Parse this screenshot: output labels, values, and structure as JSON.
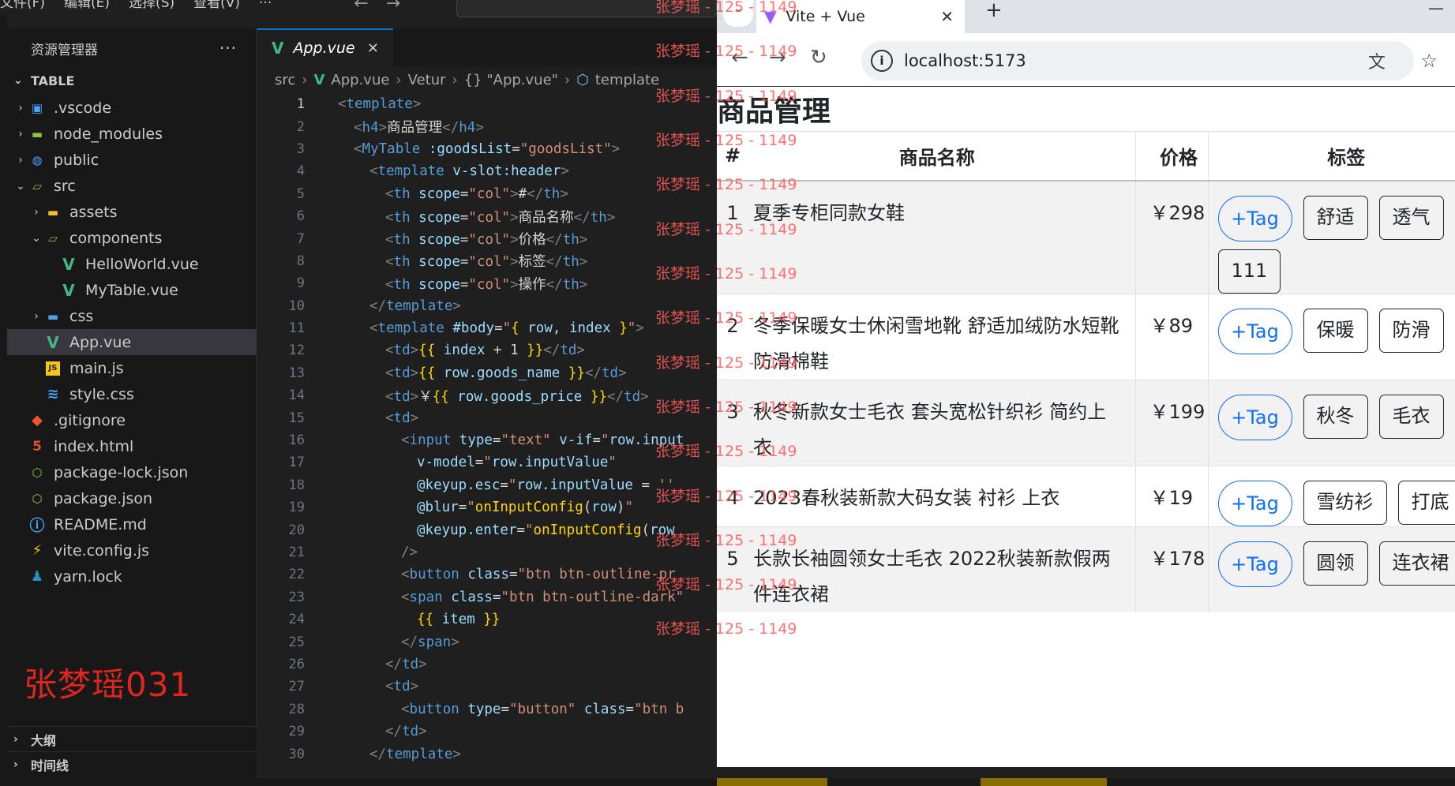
{
  "vscode": {
    "menu": [
      "文件(F)",
      "编辑(E)",
      "选择(S)",
      "查看(V)",
      "···"
    ],
    "explorer_title": "资源管理器",
    "explorer_more": "···",
    "root_folder": "TABLE",
    "tree": [
      {
        "label": ".vscode",
        "depth": 1,
        "chev": "›",
        "icon": "vscode-folder-icon",
        "glyph": "▣",
        "cls": "folder-blue"
      },
      {
        "label": "node_modules",
        "depth": 1,
        "chev": "›",
        "icon": "node-folder-icon",
        "glyph": "▬",
        "cls": "folder-green"
      },
      {
        "label": "public",
        "depth": 1,
        "chev": "›",
        "icon": "public-folder-icon",
        "glyph": "◍",
        "cls": "folder-blue"
      },
      {
        "label": "src",
        "depth": 1,
        "chev": "⌄",
        "icon": "src-folder-icon",
        "glyph": "▱",
        "cls": "folder-green"
      },
      {
        "label": "assets",
        "depth": 2,
        "chev": "›",
        "icon": "assets-folder-icon",
        "glyph": "▬",
        "cls": "folder-yellow"
      },
      {
        "label": "components",
        "depth": 2,
        "chev": "⌄",
        "icon": "components-folder-icon",
        "glyph": "▱",
        "cls": "folder-green"
      },
      {
        "label": "HelloWorld.vue",
        "depth": 3,
        "chev": "",
        "icon": "vue-file-icon",
        "glyph": "V",
        "cls": "vue"
      },
      {
        "label": "MyTable.vue",
        "depth": 3,
        "chev": "",
        "icon": "vue-file-icon",
        "glyph": "V",
        "cls": "vue"
      },
      {
        "label": "css",
        "depth": 2,
        "chev": "›",
        "icon": "css-folder-icon",
        "glyph": "▬",
        "cls": "folder-css"
      },
      {
        "label": "App.vue",
        "depth": 2,
        "chev": "",
        "icon": "vue-file-icon",
        "glyph": "V",
        "cls": "vue",
        "active": true
      },
      {
        "label": "main.js",
        "depth": 2,
        "chev": "",
        "icon": "js-file-icon",
        "glyph": "JS",
        "cls": "js"
      },
      {
        "label": "style.css",
        "depth": 2,
        "chev": "",
        "icon": "css-file-icon",
        "glyph": "≋",
        "cls": "css-file"
      },
      {
        "label": ".gitignore",
        "depth": 1,
        "chev": "",
        "icon": "git-icon",
        "glyph": "◆",
        "cls": "git"
      },
      {
        "label": "index.html",
        "depth": 1,
        "chev": "",
        "icon": "html-file-icon",
        "glyph": "5",
        "cls": "html"
      },
      {
        "label": "package-lock.json",
        "depth": 1,
        "chev": "",
        "icon": "json-file-icon",
        "glyph": "⬡",
        "cls": "json"
      },
      {
        "label": "package.json",
        "depth": 1,
        "chev": "",
        "icon": "json-file-icon",
        "glyph": "⬡",
        "cls": "json"
      },
      {
        "label": "README.md",
        "depth": 1,
        "chev": "",
        "icon": "info-icon",
        "glyph": "ⓘ",
        "cls": "info"
      },
      {
        "label": "vite.config.js",
        "depth": 1,
        "chev": "",
        "icon": "vite-bolt-icon",
        "glyph": "⚡",
        "cls": "bolt"
      },
      {
        "label": "yarn.lock",
        "depth": 1,
        "chev": "",
        "icon": "yarn-icon",
        "glyph": "♟",
        "cls": "yarn"
      }
    ],
    "watermark_name": "张梦瑶031",
    "outline_label": "大纲",
    "timeline_label": "时间线",
    "editor_tab": "App.vue",
    "breadcrumb": [
      "src",
      "App.vue",
      "Vetur",
      "{} \"App.vue\"",
      "template"
    ],
    "code_lines": [
      {
        "n": "1",
        "html": "<span class='t-br'>&lt;</span><span class='t-tag'>template</span><span class='t-br'>&gt;</span>",
        "indent": 0
      },
      {
        "n": "2",
        "html": "<span class='t-br'>&lt;</span><span class='t-tag'>h4</span><span class='t-br'>&gt;</span><span class='t-txt'>商品管理</span><span class='t-br'>&lt;/</span><span class='t-tag'>h4</span><span class='t-br'>&gt;</span>",
        "indent": 1
      },
      {
        "n": "3",
        "html": "<span class='t-br'>&lt;</span><span class='t-tag'>MyTable</span> <span class='t-attr'>:goodsList</span><span class='t-txt'>=</span><span class='t-str'>\"goodsList\"</span><span class='t-br'>&gt;</span>",
        "indent": 1
      },
      {
        "n": "4",
        "html": "<span class='t-br'>&lt;</span><span class='t-tag'>template</span> <span class='t-attr'>v-slot:header</span><span class='t-br'>&gt;</span>",
        "indent": 2
      },
      {
        "n": "5",
        "html": "<span class='t-br'>&lt;</span><span class='t-tag'>th</span> <span class='t-attr'>scope</span><span class='t-txt'>=</span><span class='t-str'>\"col\"</span><span class='t-br'>&gt;</span><span class='t-txt'>#</span><span class='t-br'>&lt;/</span><span class='t-tag'>th</span><span class='t-br'>&gt;</span>",
        "indent": 3
      },
      {
        "n": "6",
        "html": "<span class='t-br'>&lt;</span><span class='t-tag'>th</span> <span class='t-attr'>scope</span><span class='t-txt'>=</span><span class='t-str'>\"col\"</span><span class='t-br'>&gt;</span><span class='t-txt'>商品名称</span><span class='t-br'>&lt;/</span><span class='t-tag'>th</span><span class='t-br'>&gt;</span>",
        "indent": 3
      },
      {
        "n": "7",
        "html": "<span class='t-br'>&lt;</span><span class='t-tag'>th</span> <span class='t-attr'>scope</span><span class='t-txt'>=</span><span class='t-str'>\"col\"</span><span class='t-br'>&gt;</span><span class='t-txt'>价格</span><span class='t-br'>&lt;/</span><span class='t-tag'>th</span><span class='t-br'>&gt;</span>",
        "indent": 3
      },
      {
        "n": "8",
        "html": "<span class='t-br'>&lt;</span><span class='t-tag'>th</span> <span class='t-attr'>scope</span><span class='t-txt'>=</span><span class='t-str'>\"col\"</span><span class='t-br'>&gt;</span><span class='t-txt'>标签</span><span class='t-br'>&lt;/</span><span class='t-tag'>th</span><span class='t-br'>&gt;</span>",
        "indent": 3
      },
      {
        "n": "9",
        "html": "<span class='t-br'>&lt;</span><span class='t-tag'>th</span> <span class='t-attr'>scope</span><span class='t-txt'>=</span><span class='t-str'>\"col\"</span><span class='t-br'>&gt;</span><span class='t-txt'>操作</span><span class='t-br'>&lt;/</span><span class='t-tag'>th</span><span class='t-br'>&gt;</span>",
        "indent": 3
      },
      {
        "n": "10",
        "html": "<span class='t-br'>&lt;/</span><span class='t-tag'>template</span><span class='t-br'>&gt;</span>",
        "indent": 2
      },
      {
        "n": "11",
        "html": "<span class='t-br'>&lt;</span><span class='t-tag'>template</span> <span class='t-attr'>#body</span><span class='t-txt'>=</span><span class='t-str'>\"</span><span class='t-mus'>{</span> <span class='t-var'>row</span><span class='t-txt'>,</span> <span class='t-var'>index</span> <span class='t-mus'>}</span><span class='t-str'>\"</span><span class='t-br'>&gt;</span>",
        "indent": 2
      },
      {
        "n": "12",
        "html": "<span class='t-br'>&lt;</span><span class='t-tag'>td</span><span class='t-br'>&gt;</span><span class='t-mus'>{{</span> <span class='t-var'>index</span> <span class='t-txt'>+ 1</span> <span class='t-mus'>}}</span><span class='t-br'>&lt;/</span><span class='t-tag'>td</span><span class='t-br'>&gt;</span>",
        "indent": 3
      },
      {
        "n": "13",
        "html": "<span class='t-br'>&lt;</span><span class='t-tag'>td</span><span class='t-br'>&gt;</span><span class='t-mus'>{{</span> <span class='t-var'>row.goods_name</span> <span class='t-mus'>}}</span><span class='t-br'>&lt;/</span><span class='t-tag'>td</span><span class='t-br'>&gt;</span>",
        "indent": 3
      },
      {
        "n": "14",
        "html": "<span class='t-br'>&lt;</span><span class='t-tag'>td</span><span class='t-br'>&gt;</span><span class='t-txt'>￥</span><span class='t-mus'>{{</span> <span class='t-var'>row.goods_price</span> <span class='t-mus'>}}</span><span class='t-br'>&lt;/</span><span class='t-tag'>td</span><span class='t-br'>&gt;</span>",
        "indent": 3
      },
      {
        "n": "15",
        "html": "<span class='t-br'>&lt;</span><span class='t-tag'>td</span><span class='t-br'>&gt;</span>",
        "indent": 3
      },
      {
        "n": "16",
        "html": "<span class='t-br'>&lt;</span><span class='t-tag'>input</span> <span class='t-attr'>type</span><span class='t-txt'>=</span><span class='t-str'>\"text\"</span> <span class='t-attr'>v-if</span><span class='t-txt'>=</span><span class='t-str'>\"</span><span class='t-var'>row.input</span>",
        "indent": 4
      },
      {
        "n": "17",
        "html": "<span class='t-attr'>v-model</span><span class='t-txt'>=</span><span class='t-str'>\"</span><span class='t-var'>row.inputValue</span><span class='t-str'>\"</span>",
        "indent": 5
      },
      {
        "n": "18",
        "html": "<span class='t-attr'>@keyup.esc</span><span class='t-txt'>=</span><span class='t-str'>\"</span><span class='t-var'>row.inputValue</span> <span class='t-txt'>=</span> <span class='t-str'>''</span>",
        "indent": 5
      },
      {
        "n": "19",
        "html": "<span class='t-attr'>@blur</span><span class='t-txt'>=</span><span class='t-str'>\"</span><span class='t-mus'>onInputConfig</span><span class='t-txt'>(</span><span class='t-var'>row</span><span class='t-txt'>)</span><span class='t-str'>\"</span>",
        "indent": 5
      },
      {
        "n": "20",
        "html": "<span class='t-attr'>@keyup.enter</span><span class='t-txt'>=</span><span class='t-str'>\"</span><span class='t-mus'>onInputConfig</span><span class='t-txt'>(</span><span class='t-var'>row</span>",
        "indent": 5
      },
      {
        "n": "21",
        "html": "<span class='t-br'>/&gt;</span>",
        "indent": 4
      },
      {
        "n": "22",
        "html": "<span class='t-br'>&lt;</span><span class='t-tag'>button</span> <span class='t-attr'>class</span><span class='t-txt'>=</span><span class='t-str'>\"btn btn-outline-pr</span>",
        "indent": 4
      },
      {
        "n": "23",
        "html": "<span class='t-br'>&lt;</span><span class='t-tag'>span</span> <span class='t-attr'>class</span><span class='t-txt'>=</span><span class='t-str'>\"btn btn-outline-dark\"</span>",
        "indent": 4
      },
      {
        "n": "24",
        "html": "<span class='t-mus'>{{</span> <span class='t-var'>item</span> <span class='t-mus'>}}</span>",
        "indent": 5
      },
      {
        "n": "25",
        "html": "<span class='t-br'>&lt;/</span><span class='t-tag'>span</span><span class='t-br'>&gt;</span>",
        "indent": 4
      },
      {
        "n": "26",
        "html": "<span class='t-br'>&lt;/</span><span class='t-tag'>td</span><span class='t-br'>&gt;</span>",
        "indent": 3
      },
      {
        "n": "27",
        "html": "<span class='t-br'>&lt;</span><span class='t-tag'>td</span><span class='t-br'>&gt;</span>",
        "indent": 3
      },
      {
        "n": "28",
        "html": "<span class='t-br'>&lt;</span><span class='t-tag'>button</span> <span class='t-attr'>type</span><span class='t-txt'>=</span><span class='t-str'>\"button\"</span> <span class='t-attr'>class</span><span class='t-txt'>=</span><span class='t-str'>\"btn b</span>",
        "indent": 4
      },
      {
        "n": "29",
        "html": "<span class='t-br'>&lt;/</span><span class='t-tag'>td</span><span class='t-br'>&gt;</span>",
        "indent": 3
      },
      {
        "n": "30",
        "html": "<span class='t-br'>&lt;/</span><span class='t-tag'>template</span><span class='t-br'>&gt;</span>",
        "indent": 2
      }
    ]
  },
  "browser": {
    "tab_title": "Vite + Vue",
    "tab_close": "✕",
    "new_tab": "+",
    "url": "localhost:5173",
    "page": {
      "title": "商品管理",
      "headers": [
        "#",
        "商品名称",
        "价格",
        "标签"
      ],
      "add_tag_label": "+Tag",
      "rows": [
        {
          "idx": "1",
          "name": "夏季专柜同款女鞋",
          "price": "￥298",
          "tags": [
            "舒适",
            "透气",
            "111"
          ]
        },
        {
          "idx": "2",
          "name": "冬季保暖女士休闲雪地靴 舒适加绒防水短靴 防滑棉鞋",
          "price": "￥89",
          "tags": [
            "保暖",
            "防滑"
          ]
        },
        {
          "idx": "3",
          "name": "秋冬新款女士毛衣 套头宽松针织衫 简约上衣",
          "price": "￥199",
          "tags": [
            "秋冬",
            "毛衣"
          ]
        },
        {
          "idx": "4",
          "name": "2023春秋装新款大码女装 衬衫 上衣",
          "price": "￥19",
          "tags": [
            "雪纺衫",
            "打底"
          ]
        },
        {
          "idx": "5",
          "name": "长款长袖圆领女士毛衣 2022秋装新款假两件连衣裙",
          "price": "￥178",
          "tags": [
            "圆领",
            "连衣裙"
          ]
        }
      ]
    }
  },
  "watermark_text": "张梦瑶 - 125 - 1149",
  "colors": {
    "vscode_bg": "#1f1f1f",
    "sidebar_bg": "#181818",
    "accent": "#0078d4",
    "vue_green": "#41b883",
    "bootstrap_primary": "#0d6efd",
    "watermark_red": "#ff5a5a"
  }
}
